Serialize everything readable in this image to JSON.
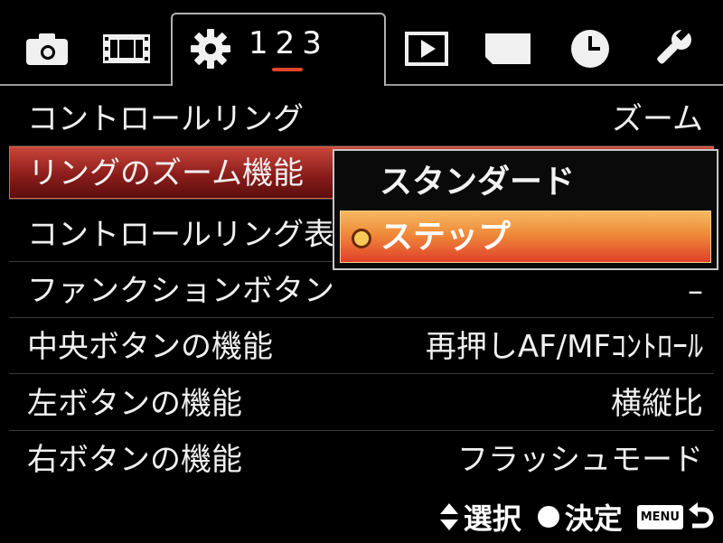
{
  "tabs": {
    "camera_icon": "camera-icon",
    "film_icon": "film-icon",
    "gear_icon": "gear-icon",
    "page_numbers": "123",
    "play_icon": "playback-icon",
    "card_icon": "memory-card-icon",
    "clock_icon": "clock-icon",
    "wrench_icon": "wrench-icon",
    "active_page": 2
  },
  "menu": {
    "items": [
      {
        "label": "コントロールリング",
        "value": "ズーム"
      },
      {
        "label": "リングのズーム機能",
        "value": ""
      },
      {
        "label": "コントロールリング表示",
        "value": ""
      },
      {
        "label": "ファンクションボタン",
        "value": "–"
      },
      {
        "label": "中央ボタンの機能",
        "value": "再押しAF/MFｺﾝﾄﾛｰﾙ"
      },
      {
        "label": "左ボタンの機能",
        "value": "横縦比"
      },
      {
        "label": "右ボタンの機能",
        "value": "フラッシュモード"
      }
    ],
    "selected_index": 1
  },
  "popup": {
    "options": [
      {
        "label": "スタンダード"
      },
      {
        "label": "ステップ"
      }
    ],
    "selected_index": 1
  },
  "footer": {
    "select_label": "選択",
    "confirm_label": "決定",
    "menu_badge": "MENU"
  },
  "colors": {
    "accent_red": "#e0452b",
    "selected_row": "#8c1d1b",
    "selected_option": "#f08a3a"
  }
}
